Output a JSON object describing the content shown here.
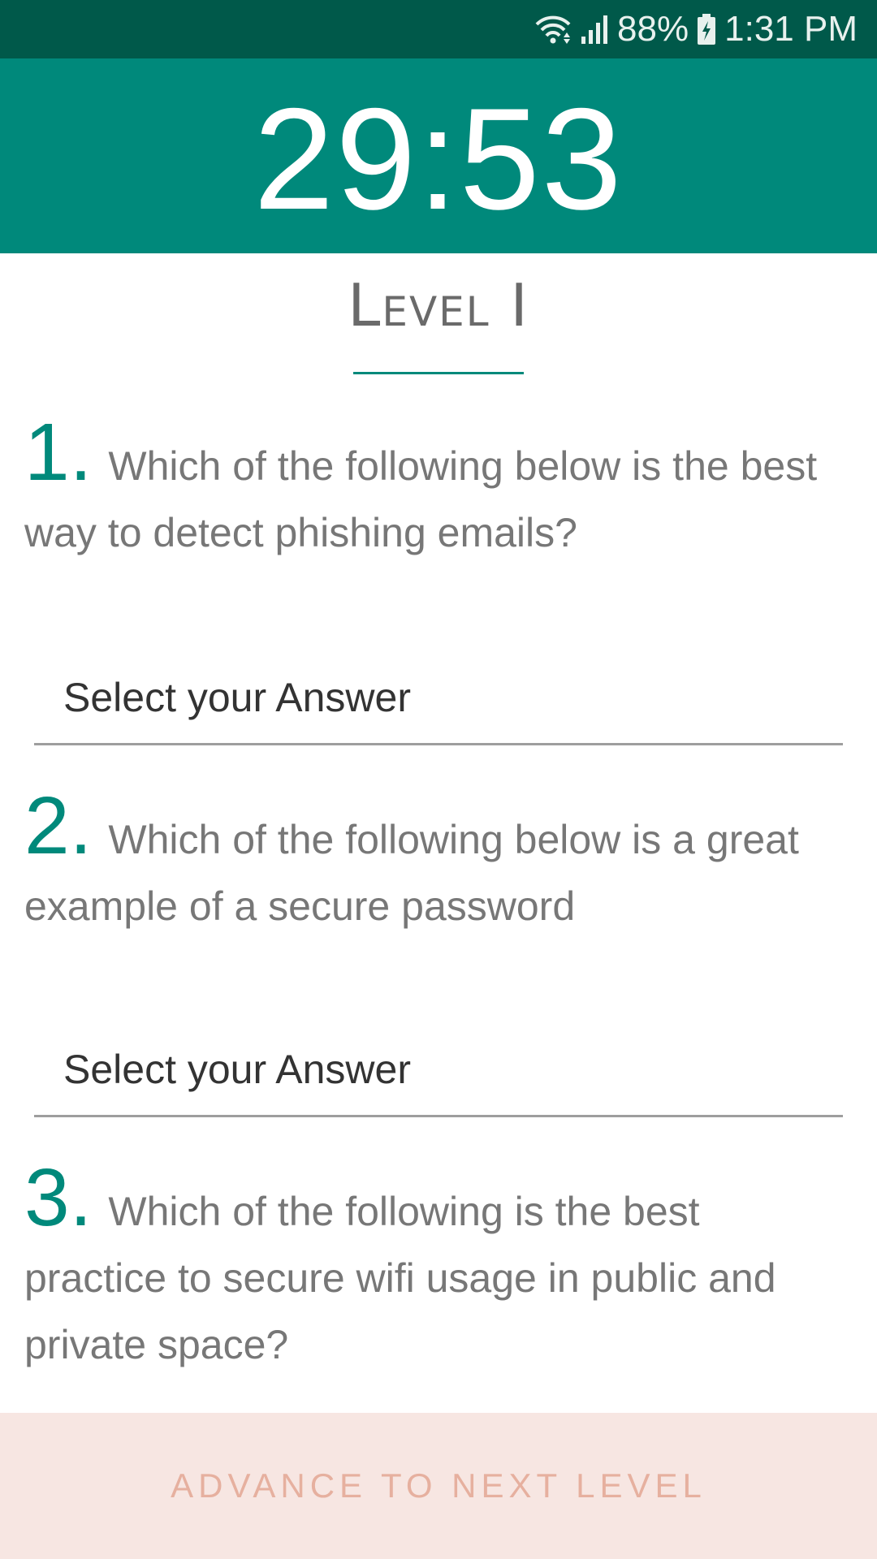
{
  "status_bar": {
    "battery": "88%",
    "time": "1:31 PM",
    "icons": [
      "wifi-icon",
      "signal-icon",
      "battery-charging-icon"
    ]
  },
  "timer": {
    "value": "29:53"
  },
  "level": {
    "title": "Level I"
  },
  "questions": [
    {
      "number": "1.",
      "text": "Which of the following below is the best way to detect phishing emails?",
      "answer_placeholder": "Select your Answer"
    },
    {
      "number": "2.",
      "text": "Which of the following below is a great example of a secure password",
      "answer_placeholder": "Select your Answer"
    },
    {
      "number": "3.",
      "text": "Which of the following is the best practice to secure wifi usage in public and private space?"
    }
  ],
  "footer": {
    "button_label": "ADVANCE TO NEXT LEVEL"
  },
  "colors": {
    "status_bar": "#00594a",
    "accent": "#00897b",
    "footer_bg": "#f7e6e2",
    "footer_text": "#e6b09f"
  }
}
